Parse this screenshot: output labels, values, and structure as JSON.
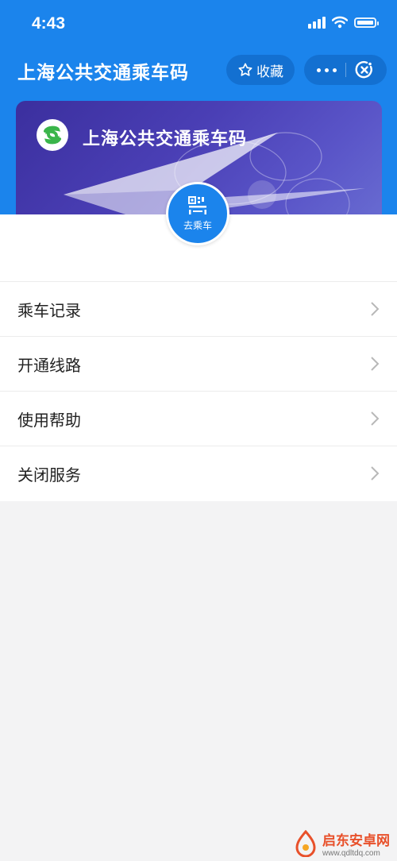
{
  "status": {
    "time": "4:43"
  },
  "header": {
    "title": "上海公共交通乘车码",
    "favorite_label": "收藏"
  },
  "card": {
    "title": "上海公共交通乘车码"
  },
  "ride_button": {
    "label": "去乘车"
  },
  "menu": [
    {
      "label": "乘车记录"
    },
    {
      "label": "开通线路"
    },
    {
      "label": "使用帮助"
    },
    {
      "label": "关闭服务"
    }
  ],
  "watermark": {
    "name": "启东安卓网",
    "url": "www.qdltdq.com"
  },
  "colors": {
    "primary": "#1b84ec",
    "card_start": "#3b2f9e",
    "card_end": "#6d73d4",
    "logo_green": "#3ab54a",
    "background": "#f3f3f4"
  }
}
